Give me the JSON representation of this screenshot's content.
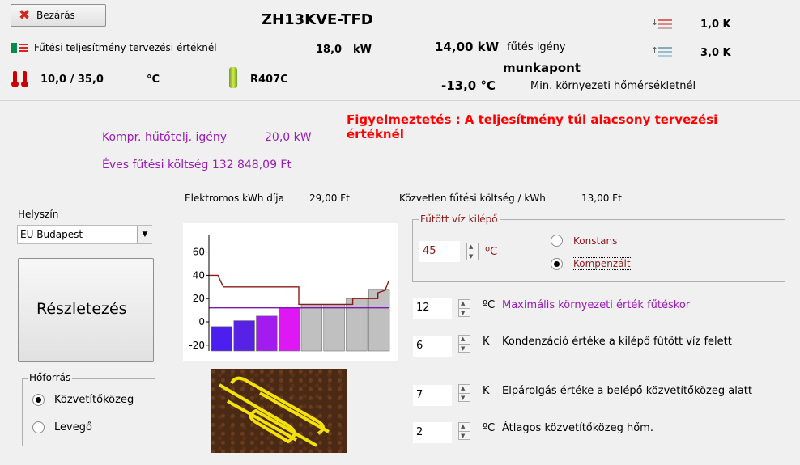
{
  "header": {
    "close_label": "Bezárás",
    "title": "ZH13KVE-TFD",
    "design_power_label": "Fűtési teljesítmény tervezési értéknél",
    "design_power_value": "18,0",
    "design_power_unit": "kW",
    "temps_value": "10,0 / 35,0",
    "temps_unit": "°C",
    "refrigerant": "R407C",
    "heating_demand_value": "14,00 kW",
    "heating_demand_label": "fűtés igény",
    "workpoint_label": "munkapont",
    "min_temp_value": "-13,0 °C",
    "min_temp_label": "Min. környezeti hőmérsékletnél",
    "delta_top": "1,0 K",
    "delta_bottom": "3,0 K"
  },
  "warning": "Figyelmeztetés : A teljesítmény túl alacsony tervezési értéknél",
  "info": {
    "compr_label": "Kompr. hűtőtelj. igény",
    "compr_value": "20,0 kW",
    "annual_cost": "Éves fűtési költség 132 848,09 Ft",
    "electric_price_label": "Elektromos kWh díja",
    "electric_price_value": "29,00 Ft",
    "direct_cost_label": "Közvetlen fűtési költség / kWh",
    "direct_cost_value": "13,00 Ft"
  },
  "location": {
    "label": "Helyszín",
    "value": "EU-Budapest"
  },
  "details_button": "Részletezés",
  "heat_source": {
    "legend": "Hőforrás",
    "option1": "Közvetítőközeg",
    "option2": "Levegő",
    "selected": "option1"
  },
  "flow_water": {
    "legend": "Fűtött víz kilépő",
    "value": "45",
    "unit": "ºC",
    "option1": "Konstans",
    "option2": "Kompenzált",
    "selected": "option2"
  },
  "params": [
    {
      "value": "12",
      "unit": "ºC",
      "label": "Maximális környezeti érték fűtéskor"
    },
    {
      "value": "6",
      "unit": "K",
      "label": "Kondenzáció értéke a kilépő fűtött víz felett"
    },
    {
      "value": "7",
      "unit": "K",
      "label": "Elpárolgás értéke a belépő közvetítőközeg alatt"
    },
    {
      "value": "2",
      "unit": "ºC",
      "label": "Átlagos közvetítőközeg hőm."
    }
  ],
  "chart_data": {
    "type": "bar",
    "ytick_labels": [
      "60",
      "40",
      "20",
      "0",
      "-20"
    ],
    "ylim": [
      -25,
      75
    ],
    "bars": [
      {
        "value": -4,
        "color": "#4c1ff0"
      },
      {
        "value": 1,
        "color": "#5722e6"
      },
      {
        "value": 5,
        "color": "#a21cf0"
      },
      {
        "value": 12,
        "color": "#de18f4"
      },
      {
        "value": 15,
        "color": "#c0c0c0"
      },
      {
        "value": 15,
        "color": "#c0c0c0"
      },
      {
        "value": 20,
        "color": "#c0c0c0"
      },
      {
        "value": 28,
        "color": "#c0c0c0"
      }
    ],
    "series": [
      {
        "kind": "step",
        "color": "#8b1a1a",
        "points": [
          [
            0,
            40
          ],
          [
            0.05,
            40
          ],
          [
            0.08,
            30
          ],
          [
            0.5,
            30
          ],
          [
            0.5,
            15
          ],
          [
            0.8,
            15
          ],
          [
            0.8,
            20
          ],
          [
            0.94,
            20
          ],
          [
            0.94,
            25
          ],
          [
            0.98,
            27
          ],
          [
            1,
            35
          ]
        ]
      },
      {
        "kind": "line",
        "color": "#7a1ab0",
        "points": [
          [
            0,
            12
          ],
          [
            1,
            12
          ]
        ]
      }
    ],
    "grid": false
  },
  "colors": {
    "warning": "#ff0000",
    "purple": "#9a1ab5",
    "darkred": "#8b1a1a"
  }
}
